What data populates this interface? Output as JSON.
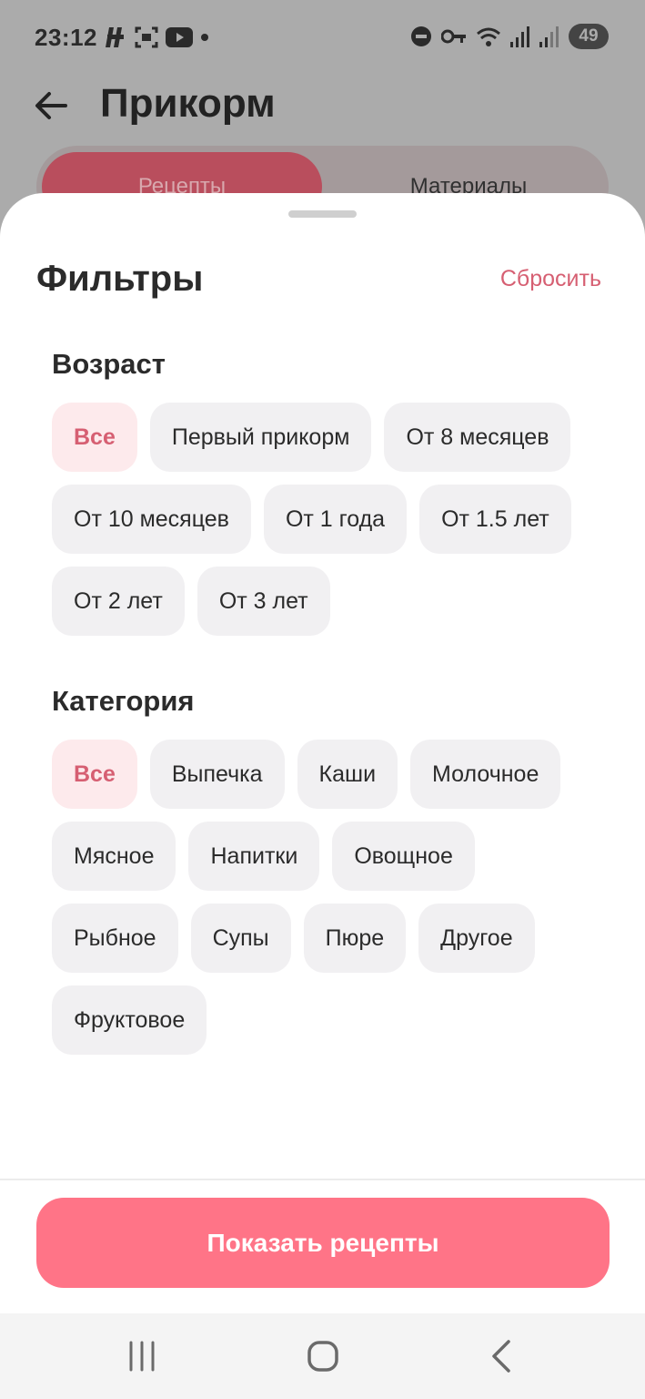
{
  "status_bar": {
    "time": "23:12",
    "battery": "49",
    "icons_left": [
      "notification-icon",
      "screenshot-icon",
      "youtube-icon",
      "dot-icon"
    ],
    "icons_right": [
      "do-not-disturb-icon",
      "key-icon",
      "wifi-icon",
      "signal-icon",
      "signal-icon-2",
      "battery-icon"
    ]
  },
  "app_bar": {
    "title": "Прикорм"
  },
  "tabs": [
    {
      "label": "Рецепты",
      "active": true
    },
    {
      "label": "Материалы",
      "active": false
    }
  ],
  "sheet": {
    "title": "Фильтры",
    "reset_label": "Сбросить",
    "age": {
      "title": "Возраст",
      "chips": [
        {
          "label": "Все",
          "selected": true
        },
        {
          "label": "Первый прикорм",
          "selected": false
        },
        {
          "label": "От 8 месяцев",
          "selected": false
        },
        {
          "label": "От 10 месяцев",
          "selected": false
        },
        {
          "label": "От 1 года",
          "selected": false
        },
        {
          "label": "От 1.5 лет",
          "selected": false
        },
        {
          "label": "От 2 лет",
          "selected": false
        },
        {
          "label": "От 3 лет",
          "selected": false
        }
      ]
    },
    "category": {
      "title": "Категория",
      "chips": [
        {
          "label": "Все",
          "selected": true
        },
        {
          "label": "Выпечка",
          "selected": false
        },
        {
          "label": "Каши",
          "selected": false
        },
        {
          "label": "Молочное",
          "selected": false
        },
        {
          "label": "Мясное",
          "selected": false
        },
        {
          "label": "Напитки",
          "selected": false
        },
        {
          "label": "Овощное",
          "selected": false
        },
        {
          "label": "Рыбное",
          "selected": false
        },
        {
          "label": "Супы",
          "selected": false
        },
        {
          "label": "Пюре",
          "selected": false
        },
        {
          "label": "Другое",
          "selected": false
        },
        {
          "label": "Фруктовое",
          "selected": false
        }
      ]
    },
    "show_button_label": "Показать рецепты"
  },
  "colors": {
    "accent": "#ff7487",
    "accent_text": "#d65f72",
    "chip_bg": "#f1f0f2",
    "chip_selected_bg": "#fdeaec"
  }
}
